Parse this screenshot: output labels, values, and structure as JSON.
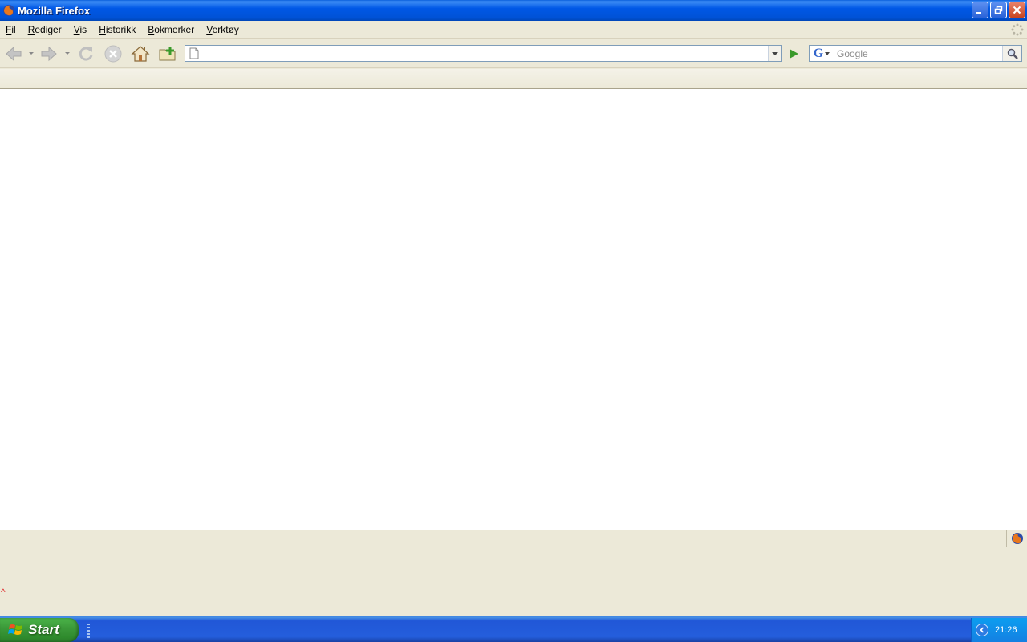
{
  "window": {
    "title": "Mozilla Firefox",
    "icon": "firefox-icon",
    "controls": [
      "minimize-icon",
      "restore-icon",
      "close-icon"
    ]
  },
  "menu": {
    "items": [
      {
        "label": "Fil"
      },
      {
        "label": "Rediger"
      },
      {
        "label": "Vis"
      },
      {
        "label": "Historikk"
      },
      {
        "label": "Bokmerker"
      },
      {
        "label": "Verktøy"
      }
    ]
  },
  "toolbar": {
    "buttons": [
      "back-icon",
      "forward-icon",
      "reload-icon",
      "stop-icon",
      "home-icon",
      "add-bookmark-icon"
    ],
    "url": {
      "value": "",
      "placeholder": ""
    },
    "search": {
      "engine": "G",
      "placeholder": "Google",
      "value": ""
    }
  },
  "statusbar": {
    "text": ""
  },
  "lower": {
    "mark": "^"
  },
  "taskbar": {
    "start_label": "Start",
    "clock": "21:26"
  },
  "colors": {
    "titlebar": "#0058e6",
    "chrome": "#ece9d8",
    "start": "#3c9a3a",
    "tray": "#0c9ef0"
  }
}
